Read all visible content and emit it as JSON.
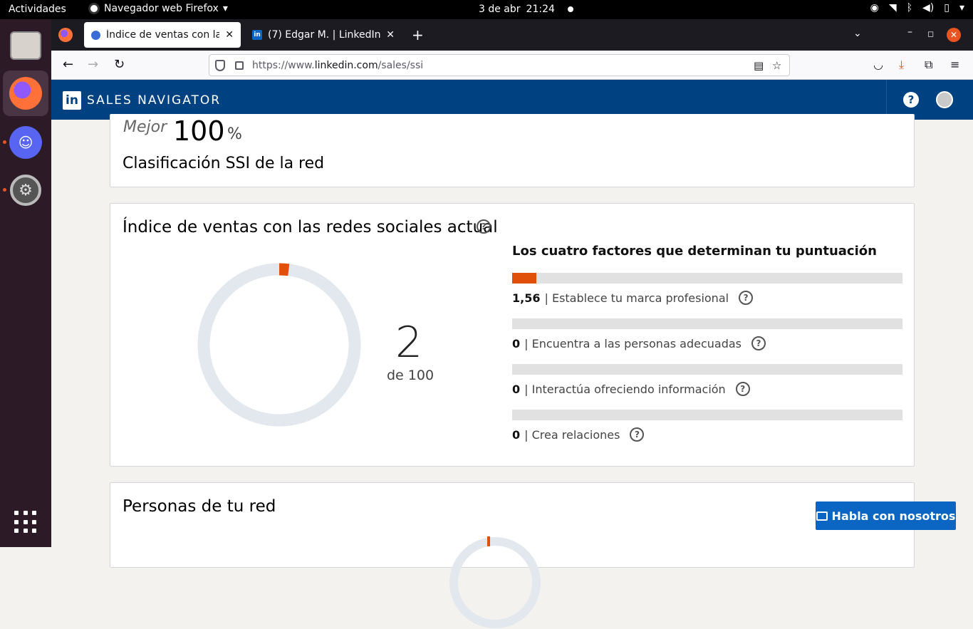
{
  "system": {
    "activities": "Actividades",
    "app_menu": "Navegador web Firefox",
    "date": "3 de abr",
    "time": "21:24"
  },
  "browser": {
    "tabs": [
      {
        "title": "Índice de ventas con las redes sociales",
        "icon": "compass-icon",
        "active": true
      },
      {
        "title": "(7) Edgar M. | LinkedIn",
        "icon": "linkedin-icon",
        "active": false
      }
    ],
    "url_prefix": "https://www.",
    "url_domain": "linkedin.com",
    "url_path": "/sales/ssi"
  },
  "header": {
    "logo": "in",
    "title": "SALES NAVIGATOR",
    "help": "?"
  },
  "network_rank": {
    "label": "Mejor",
    "value": "100",
    "unit": "%",
    "title": "Clasificación SSI de la red"
  },
  "ssi": {
    "title": "Índice de ventas con las redes sociales actual",
    "score": "2",
    "score_of": "de 100",
    "score_value": 2,
    "factors_title": "Los cuatro factores que determinan tu puntuación",
    "factors": [
      {
        "value": "1,56",
        "label": "| Establece tu marca profesional",
        "fill": 0.0624
      },
      {
        "value": "0",
        "label": "| Encuentra a las personas adecuadas",
        "fill": 0
      },
      {
        "value": "0",
        "label": "| Interactúa ofreciendo información",
        "fill": 0
      },
      {
        "value": "0",
        "label": "| Crea relaciones",
        "fill": 0
      }
    ]
  },
  "network": {
    "title": "Personas de tu red"
  },
  "chat": {
    "label": "Habla con nosotros"
  },
  "colors": {
    "accent": "#e1500a",
    "brand": "#004182",
    "donut_track": "#e2e8ee"
  }
}
